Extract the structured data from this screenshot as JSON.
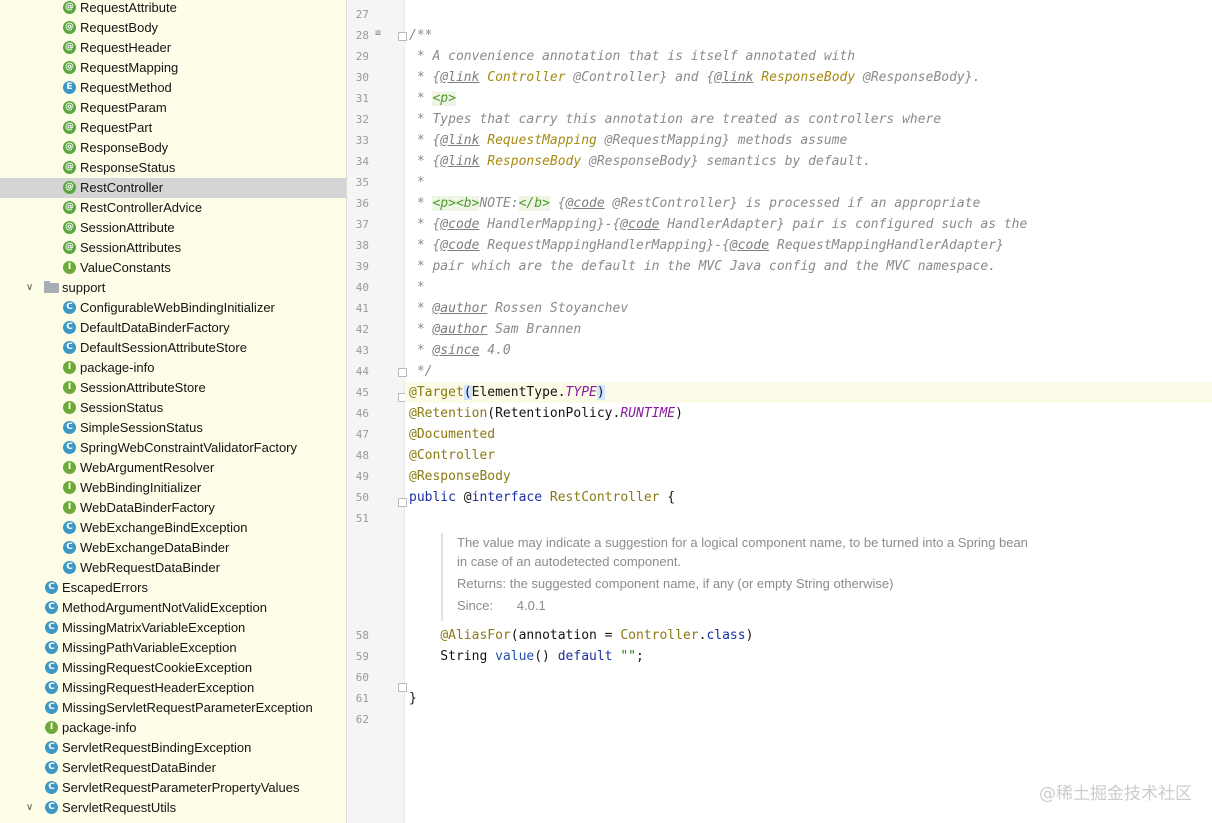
{
  "tree": {
    "items": [
      {
        "label": "RequestAttribute",
        "icon": "@",
        "kind": "annotation",
        "indent": 2
      },
      {
        "label": "RequestBody",
        "icon": "@",
        "kind": "annotation",
        "indent": 2
      },
      {
        "label": "RequestHeader",
        "icon": "@",
        "kind": "annotation",
        "indent": 2
      },
      {
        "label": "RequestMapping",
        "icon": "@",
        "kind": "annotation",
        "indent": 2
      },
      {
        "label": "RequestMethod",
        "icon": "E",
        "kind": "enum",
        "indent": 2
      },
      {
        "label": "RequestParam",
        "icon": "@",
        "kind": "annotation",
        "indent": 2
      },
      {
        "label": "RequestPart",
        "icon": "@",
        "kind": "annotation",
        "indent": 2
      },
      {
        "label": "ResponseBody",
        "icon": "@",
        "kind": "annotation",
        "indent": 2
      },
      {
        "label": "ResponseStatus",
        "icon": "@",
        "kind": "annotation",
        "indent": 2
      },
      {
        "label": "RestController",
        "icon": "@",
        "kind": "annotation",
        "indent": 2,
        "selected": true
      },
      {
        "label": "RestControllerAdvice",
        "icon": "@",
        "kind": "annotation",
        "indent": 2
      },
      {
        "label": "SessionAttribute",
        "icon": "@",
        "kind": "annotation",
        "indent": 2
      },
      {
        "label": "SessionAttributes",
        "icon": "@",
        "kind": "annotation",
        "indent": 2
      },
      {
        "label": "ValueConstants",
        "icon": "I",
        "kind": "interface",
        "indent": 2
      },
      {
        "label": "support",
        "icon": "folder",
        "kind": "folder",
        "indent": 1,
        "expanded": true
      },
      {
        "label": "ConfigurableWebBindingInitializer",
        "icon": "C",
        "kind": "class",
        "indent": 2
      },
      {
        "label": "DefaultDataBinderFactory",
        "icon": "C",
        "kind": "class",
        "indent": 2
      },
      {
        "label": "DefaultSessionAttributeStore",
        "icon": "C",
        "kind": "class",
        "indent": 2
      },
      {
        "label": "package-info",
        "icon": "I",
        "kind": "interface",
        "indent": 2
      },
      {
        "label": "SessionAttributeStore",
        "icon": "I",
        "kind": "interface",
        "indent": 2
      },
      {
        "label": "SessionStatus",
        "icon": "I",
        "kind": "interface",
        "indent": 2
      },
      {
        "label": "SimpleSessionStatus",
        "icon": "C",
        "kind": "class",
        "indent": 2
      },
      {
        "label": "SpringWebConstraintValidatorFactory",
        "icon": "C",
        "kind": "class",
        "indent": 2
      },
      {
        "label": "WebArgumentResolver",
        "icon": "I",
        "kind": "interface",
        "indent": 2
      },
      {
        "label": "WebBindingInitializer",
        "icon": "I",
        "kind": "interface",
        "indent": 2
      },
      {
        "label": "WebDataBinderFactory",
        "icon": "I",
        "kind": "interface",
        "indent": 2
      },
      {
        "label": "WebExchangeBindException",
        "icon": "C",
        "kind": "class",
        "indent": 2
      },
      {
        "label": "WebExchangeDataBinder",
        "icon": "C",
        "kind": "class",
        "indent": 2
      },
      {
        "label": "WebRequestDataBinder",
        "icon": "C",
        "kind": "class",
        "indent": 2
      },
      {
        "label": "EscapedErrors",
        "icon": "C",
        "kind": "class",
        "indent": 1
      },
      {
        "label": "MethodArgumentNotValidException",
        "icon": "C",
        "kind": "class",
        "indent": 1
      },
      {
        "label": "MissingMatrixVariableException",
        "icon": "C",
        "kind": "class",
        "indent": 1
      },
      {
        "label": "MissingPathVariableException",
        "icon": "C",
        "kind": "class",
        "indent": 1
      },
      {
        "label": "MissingRequestCookieException",
        "icon": "C",
        "kind": "class",
        "indent": 1
      },
      {
        "label": "MissingRequestHeaderException",
        "icon": "C",
        "kind": "class",
        "indent": 1
      },
      {
        "label": "MissingServletRequestParameterException",
        "icon": "C",
        "kind": "class",
        "indent": 1
      },
      {
        "label": "package-info",
        "icon": "I",
        "kind": "interface",
        "indent": 1
      },
      {
        "label": "ServletRequestBindingException",
        "icon": "C",
        "kind": "class",
        "indent": 1
      },
      {
        "label": "ServletRequestDataBinder",
        "icon": "C",
        "kind": "class",
        "indent": 1
      },
      {
        "label": "ServletRequestParameterPropertyValues",
        "icon": "C",
        "kind": "class",
        "indent": 1
      },
      {
        "label": "ServletRequestUtils",
        "icon": "C",
        "kind": "class",
        "indent": 1,
        "expanded": true
      }
    ]
  },
  "colors": {
    "annotation_icon": "#5aa53f",
    "class_icon": "#3c98c5",
    "interface_icon": "#6fa83b",
    "enum_icon": "#3c98c5",
    "selection": "#d5d5d5",
    "tree_background": "#fefee8"
  },
  "editor": {
    "lines": [
      {
        "n": "27",
        "html": ""
      },
      {
        "n": "28",
        "html": "<span class=\"doc\">/**</span>"
      },
      {
        "n": "29",
        "html": "<span class=\"doc\"> * A convenience annotation that is itself annotated with</span>"
      },
      {
        "n": "30",
        "html": "<span class=\"doc\"> * {</span><span class=\"dtag\">@link</span><span class=\"doc\"> </span><span class=\"dref\">Controller</span><span class=\"doc\"> @Controller} and {</span><span class=\"dtag\">@link</span><span class=\"doc\"> </span><span class=\"dref\">ResponseBody</span><span class=\"doc\"> @ResponseBody}.</span>"
      },
      {
        "n": "31",
        "html": "<span class=\"doc\"> * </span><span class=\"dhtml\">&lt;p&gt;</span>"
      },
      {
        "n": "32",
        "html": "<span class=\"doc\"> * Types that carry this annotation are treated as controllers where</span>"
      },
      {
        "n": "33",
        "html": "<span class=\"doc\"> * {</span><span class=\"dtag\">@link</span><span class=\"doc\"> </span><span class=\"dref\">RequestMapping</span><span class=\"doc\"> @RequestMapping} methods assume</span>"
      },
      {
        "n": "34",
        "html": "<span class=\"doc\"> * {</span><span class=\"dtag\">@link</span><span class=\"doc\"> </span><span class=\"dref\">ResponseBody</span><span class=\"doc\"> @ResponseBody} semantics by default.</span>"
      },
      {
        "n": "35",
        "html": "<span class=\"doc\"> *</span>"
      },
      {
        "n": "36",
        "html": "<span class=\"doc\"> * </span><span class=\"dhtml\">&lt;p&gt;&lt;b&gt;</span><span class=\"doc\">NOTE:</span><span class=\"dhtml\">&lt;/b&gt;</span><span class=\"doc\"> {</span><span class=\"dtag\">@code</span><span class=\"doc\"> @RestController} is processed if an appropriate</span>"
      },
      {
        "n": "37",
        "html": "<span class=\"doc\"> * {</span><span class=\"dtag\">@code</span><span class=\"doc\"> HandlerMapping}-{</span><span class=\"dtag\">@code</span><span class=\"doc\"> HandlerAdapter} pair is configured such as the</span>"
      },
      {
        "n": "38",
        "html": "<span class=\"doc\"> * {</span><span class=\"dtag\">@code</span><span class=\"doc\"> RequestMappingHandlerMapping}-{</span><span class=\"dtag\">@code</span><span class=\"doc\"> RequestMappingHandlerAdapter}</span>"
      },
      {
        "n": "39",
        "html": "<span class=\"doc\"> * pair which are the default in the MVC Java config and the MVC namespace.</span>"
      },
      {
        "n": "40",
        "html": "<span class=\"doc\"> *</span>"
      },
      {
        "n": "41",
        "html": "<span class=\"doc\"> * </span><span class=\"dtag\">@author</span><span class=\"doc\"> Rossen Stoyanchev</span>"
      },
      {
        "n": "42",
        "html": "<span class=\"doc\"> * </span><span class=\"dtag\">@author</span><span class=\"doc\"> Sam Brannen</span>"
      },
      {
        "n": "43",
        "html": "<span class=\"doc\"> * </span><span class=\"dtag\">@since</span><span class=\"doc\"> 4.0</span>"
      },
      {
        "n": "44",
        "html": "<span class=\"doc\"> */</span>"
      },
      {
        "n": "45",
        "html": "<span class=\"ann\">@Target</span><span class=\"paren\">(</span>ElementType.<span class=\"cst\">TYPE</span><span class=\"paren\">)</span>",
        "highlight": true
      },
      {
        "n": "46",
        "html": "<span class=\"ann\">@Retention</span>(RetentionPolicy.<span class=\"cst\">RUNTIME</span>)"
      },
      {
        "n": "47",
        "html": "<span class=\"ann\">@Documented</span>"
      },
      {
        "n": "48",
        "html": "<span class=\"ann\">@Controller</span>"
      },
      {
        "n": "49",
        "html": "<span class=\"ann\">@ResponseBody</span>"
      },
      {
        "n": "50",
        "html": "<span class=\"kw\">public</span> @<span class=\"kw\">interface</span> <span class=\"cls\">RestController</span> {"
      },
      {
        "n": "51",
        "html": ""
      }
    ],
    "lines2": [
      {
        "n": "58",
        "html": "    <span class=\"ann\">@AliasFor</span>(annotation = <span class=\"cls\">Controller</span>.<span class=\"kw\">class</span>)"
      },
      {
        "n": "59",
        "html": "    String <span class=\"fn\">value</span>() <span class=\"kw\">default</span> <span class=\"str\">\"\"</span>;"
      },
      {
        "n": "60",
        "html": ""
      },
      {
        "n": "61",
        "html": "}"
      },
      {
        "n": "62",
        "html": ""
      }
    ]
  },
  "quickdoc": {
    "line1": "The value may indicate a suggestion for a logical component name, to be turned into a Spring bean",
    "line2": "in case of an autodetected component.",
    "returns": "Returns: the suggested component name, if any (or empty String otherwise)",
    "since_label": "Since:",
    "since_value": "4.0.1"
  },
  "watermark": "@稀土掘金技术社区"
}
